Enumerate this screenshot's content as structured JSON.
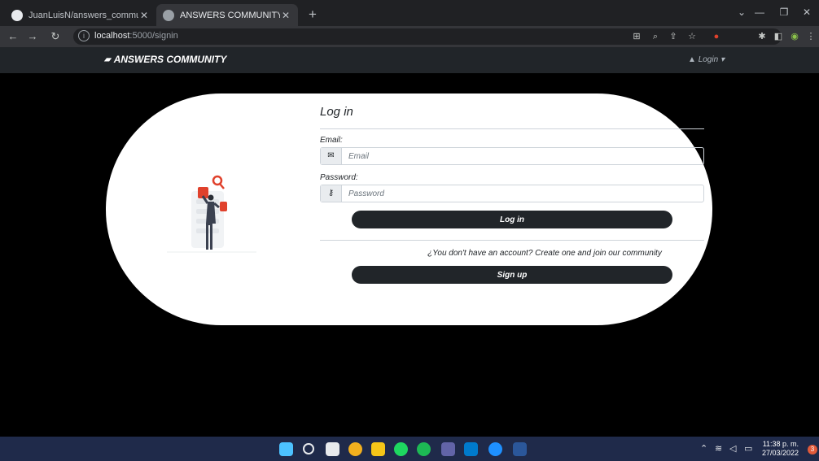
{
  "browser": {
    "tabs": [
      {
        "title": "JuanLuisN/answers_community"
      },
      {
        "title": "ANSWERS COMMUNITY"
      }
    ],
    "url_host": "localhost",
    "url_path": ":5000/signin"
  },
  "site": {
    "brand": "ANSWERS COMMUNITY",
    "login_menu": "Login"
  },
  "form": {
    "title": "Log in",
    "email_label": "Email:",
    "email_placeholder": "Email",
    "password_label": "Password:",
    "password_placeholder": "Password",
    "login_button": "Log in",
    "signup_prompt": "¿You don't have an account? Create one and join our community",
    "signup_button": "Sign up"
  },
  "taskbar": {
    "time": "11:38 p. m.",
    "date": "27/03/2022",
    "notifications": "3"
  },
  "colors": {
    "accent": "#212529",
    "illustration_red": "#e0412c"
  }
}
